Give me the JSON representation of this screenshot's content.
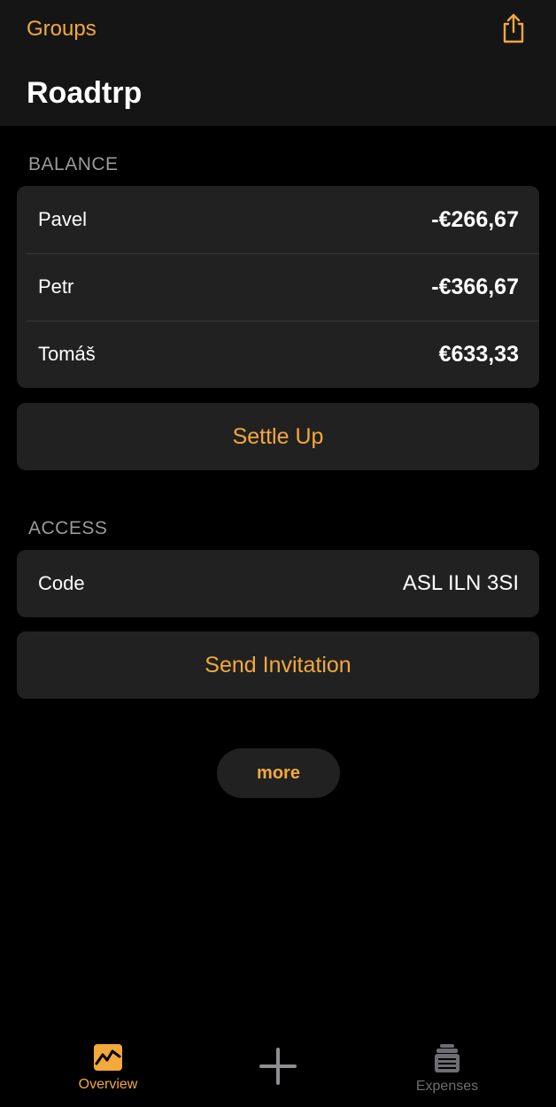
{
  "nav": {
    "back_label": "Groups",
    "share_icon": "share-icon",
    "title": "Roadtrp"
  },
  "balance": {
    "header": "BALANCE",
    "rows": [
      {
        "name": "Pavel",
        "amount": "-€266,67"
      },
      {
        "name": "Petr",
        "amount": "-€366,67"
      },
      {
        "name": "Tomáš",
        "amount": "€633,33"
      }
    ],
    "settle_label": "Settle Up"
  },
  "access": {
    "header": "ACCESS",
    "code_label": "Code",
    "code_value": "ASL ILN 3SI",
    "invite_label": "Send Invitation"
  },
  "more_label": "more",
  "tabbar": {
    "overview_label": "Overview",
    "add_icon": "plus-icon",
    "expenses_label": "Expenses"
  },
  "colors": {
    "accent": "#f3a93b",
    "background": "#000000",
    "card": "#212121",
    "header_bar": "#151515",
    "secondary_text": "#9a9a9e",
    "inactive_tab": "#6e6e72"
  }
}
